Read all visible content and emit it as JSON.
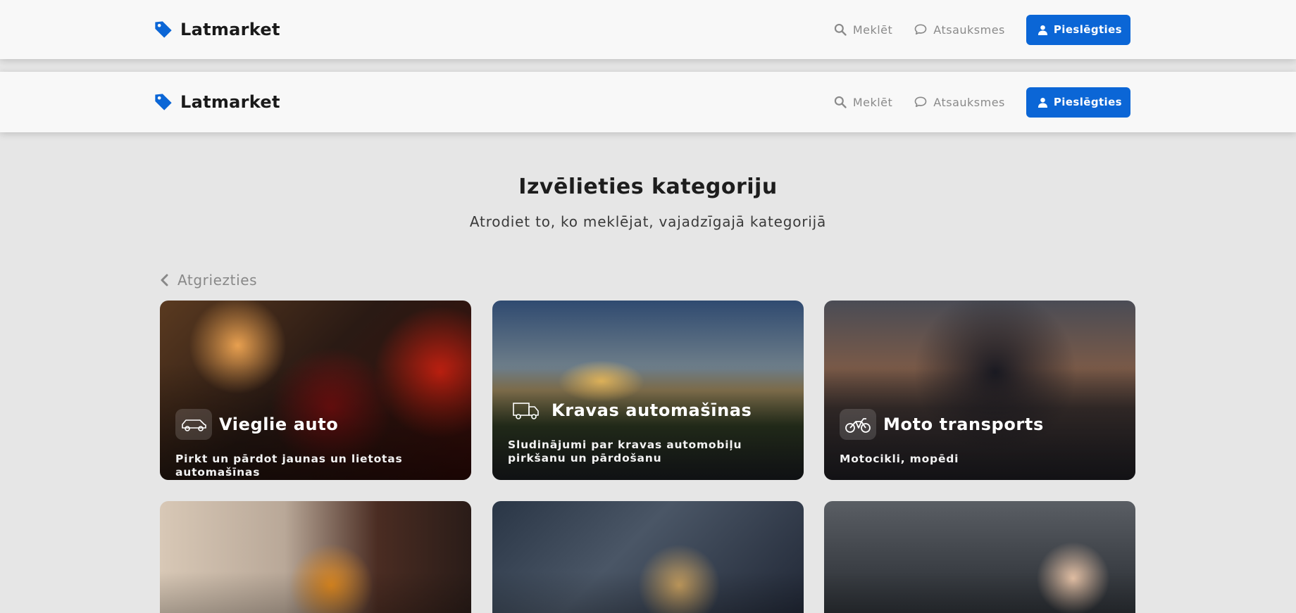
{
  "header": {
    "brand": "Latmarket",
    "search_label": "Meklēt",
    "reviews_label": "Atsauksmes",
    "login_label": "Pieslēgties"
  },
  "hero": {
    "title": "Izvēlieties kategoriju",
    "subtitle": "Atrodiet to, ko meklējat, vajadzīgajā kategorijā"
  },
  "back_label": "Atgriezties",
  "categories": [
    {
      "title": "Vieglie auto",
      "description": "Pirkt un pārdot jaunas un lietotas automašīnas",
      "icon": "car-icon"
    },
    {
      "title": "Kravas automašīnas",
      "description": "Sludinājumi par kravas automobiļu pirkšanu un pārdošanu",
      "icon": "truck-icon"
    },
    {
      "title": "Moto transports",
      "description": "Motocikli, mopēdi",
      "icon": "motorcycle-icon"
    },
    {
      "title": "",
      "description": "",
      "icon": "bicycle"
    },
    {
      "title": "",
      "description": "",
      "icon": "parts"
    },
    {
      "title": "",
      "description": "",
      "icon": "key"
    }
  ],
  "colors": {
    "accent": "#0b66d6",
    "background": "#e6e6e6",
    "header_bg": "#f8f8f8"
  }
}
